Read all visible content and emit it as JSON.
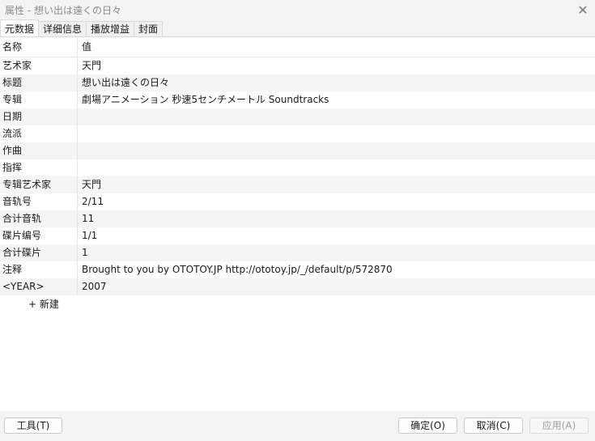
{
  "window": {
    "title": "属性 - 想い出は遠くの日々",
    "close_icon": "close-icon"
  },
  "tabs": [
    {
      "label": "元数据",
      "active": true
    },
    {
      "label": "详细信息",
      "active": false
    },
    {
      "label": "播放增益",
      "active": false
    },
    {
      "label": "封面",
      "active": false
    }
  ],
  "table": {
    "headers": {
      "name": "名称",
      "value": "值"
    },
    "rows": [
      {
        "name": "艺术家",
        "value": "天門"
      },
      {
        "name": "标题",
        "value": "想い出は遠くの日々"
      },
      {
        "name": "专辑",
        "value": "劇場アニメーション  秒速5センチメートル Soundtracks"
      },
      {
        "name": "日期",
        "value": ""
      },
      {
        "name": "流派",
        "value": ""
      },
      {
        "name": "作曲",
        "value": ""
      },
      {
        "name": "指挥",
        "value": ""
      },
      {
        "name": "专辑艺术家",
        "value": "天門"
      },
      {
        "name": "音轨号",
        "value": "2/11"
      },
      {
        "name": "合计音轨",
        "value": "11"
      },
      {
        "name": "碟片编号",
        "value": "1/1"
      },
      {
        "name": "合计碟片",
        "value": "1"
      },
      {
        "name": "注释",
        "value": "Brought to you by OTOTOY.JP http://ototoy.jp/_/default/p/572870"
      },
      {
        "name": "<YEAR>",
        "value": "2007"
      }
    ],
    "add_label": "+ 新建"
  },
  "footer": {
    "tools_label": "工具(T)",
    "ok_label": "确定(O)",
    "cancel_label": "取消(C)",
    "apply_label": "应用(A)",
    "apply_enabled": false
  }
}
